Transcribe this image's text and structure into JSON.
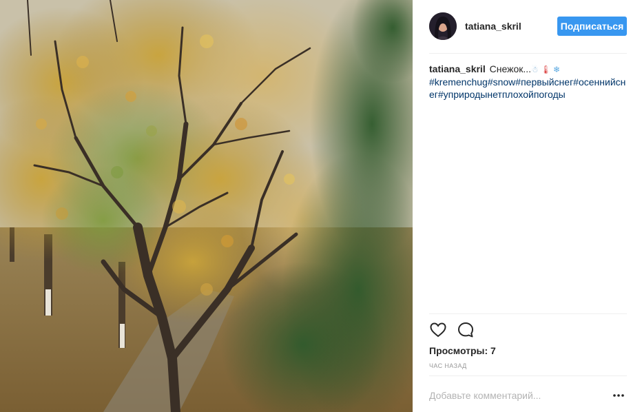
{
  "post": {
    "author": {
      "username": "tatiana_skril",
      "avatar_icon": "user-avatar"
    },
    "follow_label": "Подписаться",
    "caption": {
      "username": "tatiana_skril",
      "text": "Снежок...",
      "emojis": [
        "snowman-emoji",
        "thermometer-emoji",
        "snowflake-emoji"
      ],
      "hashtags_line": "#kremenchug#snow#первыйснег#осеннийснег#уприродынетплохойпогоды"
    },
    "actions": {
      "like_icon": "heart-icon",
      "comment_icon": "comment-icon"
    },
    "views": "Просмотры: 7",
    "timestamp": "час назад",
    "comment": {
      "placeholder": "Добавьте комментарий...",
      "more_icon": "more-options-icon"
    }
  },
  "colors": {
    "accent": "#3897f0",
    "hashtag": "#003569",
    "muted": "#999999"
  }
}
